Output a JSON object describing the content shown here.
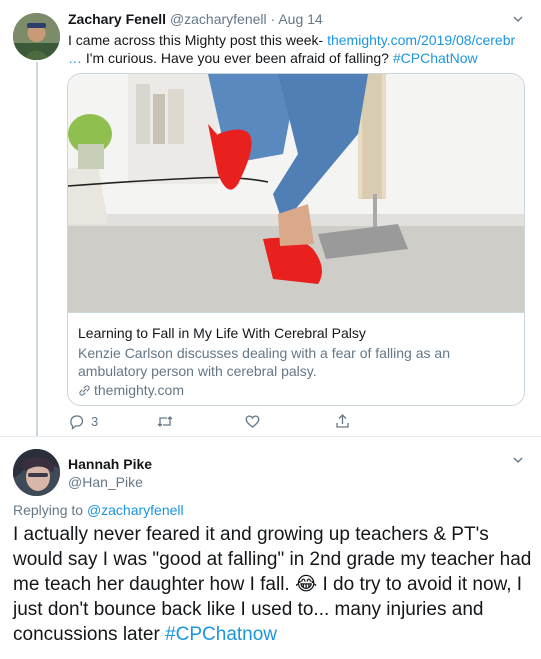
{
  "tweet1": {
    "name": "Zachary Fenell",
    "handle": "@zacharyfenell",
    "separator": "·",
    "date": "Aug 14",
    "text_part1": "I came across this Mighty post this week- ",
    "url": "themighty.com/2019/08/cerebr",
    "text_ellipsis": "…",
    "text_part2": " I'm curious. Have you ever been afraid of falling? ",
    "hashtag": "#CPChatNow",
    "card": {
      "title": "Learning to Fall in My Life With Cerebral Palsy",
      "description": "Kenzie Carlson discusses dealing with a fear of falling as an ambulatory person with cerebral palsy.",
      "domain": "themighty.com"
    },
    "actions": {
      "reply_count": "3",
      "retweet_count": "",
      "like_count": ""
    }
  },
  "tweet2": {
    "name": "Hannah Pike",
    "handle": "@Han_Pike",
    "replying_prefix": "Replying to ",
    "replying_to": "@zacharyfenell",
    "text": "I actually never feared it and growing up teachers & PT's would say I was \"good at falling\" in 2nd grade my teacher had me teach her daughter how I fall. 😂 I do try to avoid it now, I just don't bounce back like I used to...  many injuries and concussions later ",
    "hashtag": "#CPChatnow"
  },
  "colors": {
    "link": "#1b95e0",
    "secondary_text": "#657786",
    "border": "#ccd6dd",
    "slipper": "#e8201e",
    "jeans": "#4f7fb5"
  }
}
